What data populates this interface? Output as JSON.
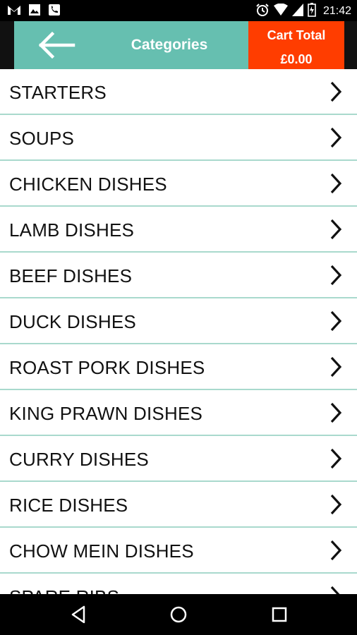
{
  "status_bar": {
    "time": "21:42",
    "left_icons": [
      "gmail-icon",
      "image-icon",
      "phone-app-icon"
    ],
    "right_icons": [
      "alarm-icon",
      "wifi-icon",
      "signal-icon",
      "battery-icon"
    ]
  },
  "header": {
    "title": "Categories",
    "back_icon": "arrow-left-icon",
    "background": "#66bfb0"
  },
  "cart": {
    "label": "Cart Total",
    "value": "£0.00",
    "background": "#ff3d00"
  },
  "categories": [
    {
      "label": "STARTERS"
    },
    {
      "label": "SOUPS"
    },
    {
      "label": "CHICKEN DISHES"
    },
    {
      "label": "LAMB DISHES"
    },
    {
      "label": "BEEF DISHES"
    },
    {
      "label": "DUCK DISHES"
    },
    {
      "label": "ROAST PORK DISHES"
    },
    {
      "label": "KING PRAWN DISHES"
    },
    {
      "label": "CURRY DISHES"
    },
    {
      "label": "RICE DISHES"
    },
    {
      "label": "CHOW MEIN DISHES"
    },
    {
      "label": "SPARE RIBS"
    }
  ],
  "nav_bar": {
    "buttons": [
      "back-triangle-icon",
      "home-circle-icon",
      "recents-square-icon"
    ]
  },
  "colors": {
    "divider": "#a9d9cd",
    "text": "#111111"
  }
}
